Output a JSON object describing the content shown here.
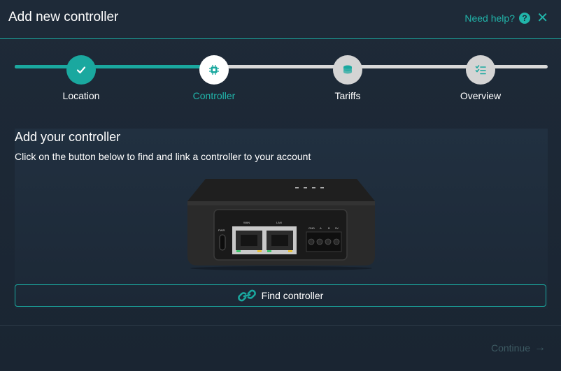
{
  "dialog": {
    "title": "Add new controller",
    "help_label": "Need help?",
    "help_icon": "question-icon",
    "close_icon": "close-icon"
  },
  "stepper": {
    "progress_fraction": 0.375,
    "steps": [
      {
        "label": "Location",
        "state": "done",
        "icon": "check-icon"
      },
      {
        "label": "Controller",
        "state": "active",
        "icon": "chip-icon"
      },
      {
        "label": "Tariffs",
        "state": "todo",
        "icon": "coins-icon"
      },
      {
        "label": "Overview",
        "state": "todo",
        "icon": "checklist-icon"
      }
    ]
  },
  "content": {
    "title": "Add your controller",
    "description": "Click on the button below to find and link a controller to your account",
    "device": {
      "port_labels": [
        "PWR",
        "WAN",
        "LAN",
        "GND",
        "A",
        "B",
        "5V"
      ]
    },
    "find_button_label": "Find controller",
    "find_button_icon": "link-icon"
  },
  "footer": {
    "continue_label": "Continue",
    "continue_icon": "arrow-right-icon"
  },
  "colors": {
    "accent": "#1aa89f",
    "background": "#1e2a38",
    "disabled_text": "#3d5a62"
  }
}
